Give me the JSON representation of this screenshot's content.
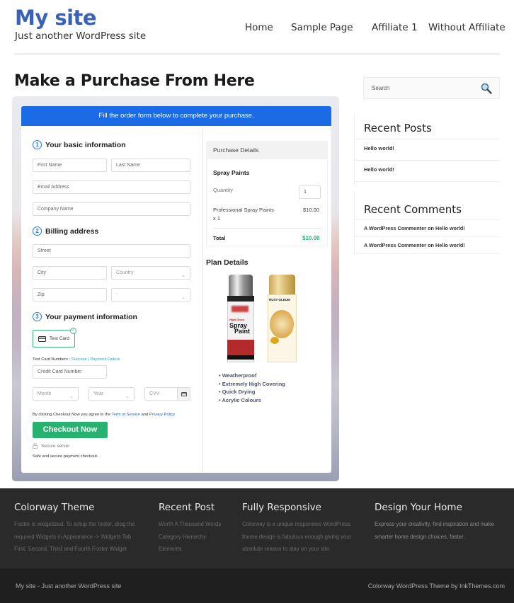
{
  "header": {
    "site_title": "My site",
    "tagline": "Just another WordPress site",
    "nav": [
      "Home",
      "Sample Page",
      "Affiliate 1",
      "Without Affiliate"
    ]
  },
  "page": {
    "title": "Make a Purchase From Here"
  },
  "form": {
    "banner": "Fill the order form below to complete your purchase.",
    "section1": {
      "num": "1",
      "title": "Your basic information"
    },
    "first_name": "First Name",
    "last_name": "Last Name",
    "email": "Email Address",
    "company": "Company Name",
    "section2": {
      "num": "2",
      "title": "Billing address"
    },
    "street": "Street",
    "city": "City",
    "country": "Country",
    "zip": "Zip",
    "state": "-",
    "section3": {
      "num": "3",
      "title": "Your payment information"
    },
    "test_card_label": "Test Card",
    "test_card_numbers_label": "Test Card Numbers :",
    "success_link": "Success",
    "separator": "|",
    "failure_link": "Payment Failure",
    "card_number": "Credit Card Number",
    "month": "Month",
    "year": "Year",
    "cvv": "CVV",
    "agree_prefix": "By clicking Checkout Now you agree to the",
    "terms_link": "Term of Service",
    "and": "and",
    "privacy_link": "Privacy Policy",
    "checkout_button": "Checkout Now",
    "secure_server": "Secure server",
    "safe_text": "Safe and secure payment checkout."
  },
  "purchase": {
    "header": "Purchase Details",
    "product": "Spray Paints",
    "quantity_label": "Quantity",
    "quantity_value": "1",
    "line_item": "Professional Spray Paints",
    "line_qty": "x 1",
    "line_price": "$10.00",
    "total_label": "Total",
    "total_value": "$10.00"
  },
  "plan": {
    "title": "Plan Details",
    "features": [
      "Weatherproof",
      "Extremely High Covering",
      "Quick Drying",
      "Acrylic Colours"
    ],
    "can1_text": [
      "High Gloss",
      "Spray",
      "Paint"
    ],
    "can2_text": "RUST-OLEUM"
  },
  "sidebar": {
    "search_placeholder": "Search",
    "recent_posts_title": "Recent Posts",
    "recent_posts": [
      "Hello world!",
      "Hello world!"
    ],
    "recent_comments_title": "Recent Comments",
    "comments": [
      {
        "author": "A WordPress Commenter",
        "on": "on",
        "post": "Hello world!"
      },
      {
        "author": "A WordPress Commenter",
        "on": "on",
        "post": "Hello world!"
      }
    ]
  },
  "footer": {
    "col1": {
      "title": "Colorway Theme",
      "text": [
        "Footer is widgetized. To setup the footer, drag the",
        "required Widgets in Appearance -> Widgets Tab",
        "First, Second, Third and Fourth Footer Widget"
      ]
    },
    "col2": {
      "title": "Recent Post",
      "links": [
        "Worth A Thousand Words",
        "Category Hierarchy",
        "Elements"
      ]
    },
    "col3": {
      "title": "Fully Responsive",
      "text": [
        "Colorway is a unique responsive WordPress",
        "theme design is fabulous enough giving your",
        "absolute reason to stay on your site."
      ]
    },
    "col4": {
      "title": "Design Your Home",
      "text": [
        "Express your creativity, find inspiration and make",
        "smarter home design choices, faster."
      ]
    },
    "bottom_left": "My site - Just another WordPress site",
    "bottom_right": "Colorway WordPress Theme by InkThemes.com"
  },
  "colors": {
    "brand": "#3a61b8",
    "banner": "#1c6be6",
    "checkout": "#27b36f",
    "total": "#27b36f"
  }
}
